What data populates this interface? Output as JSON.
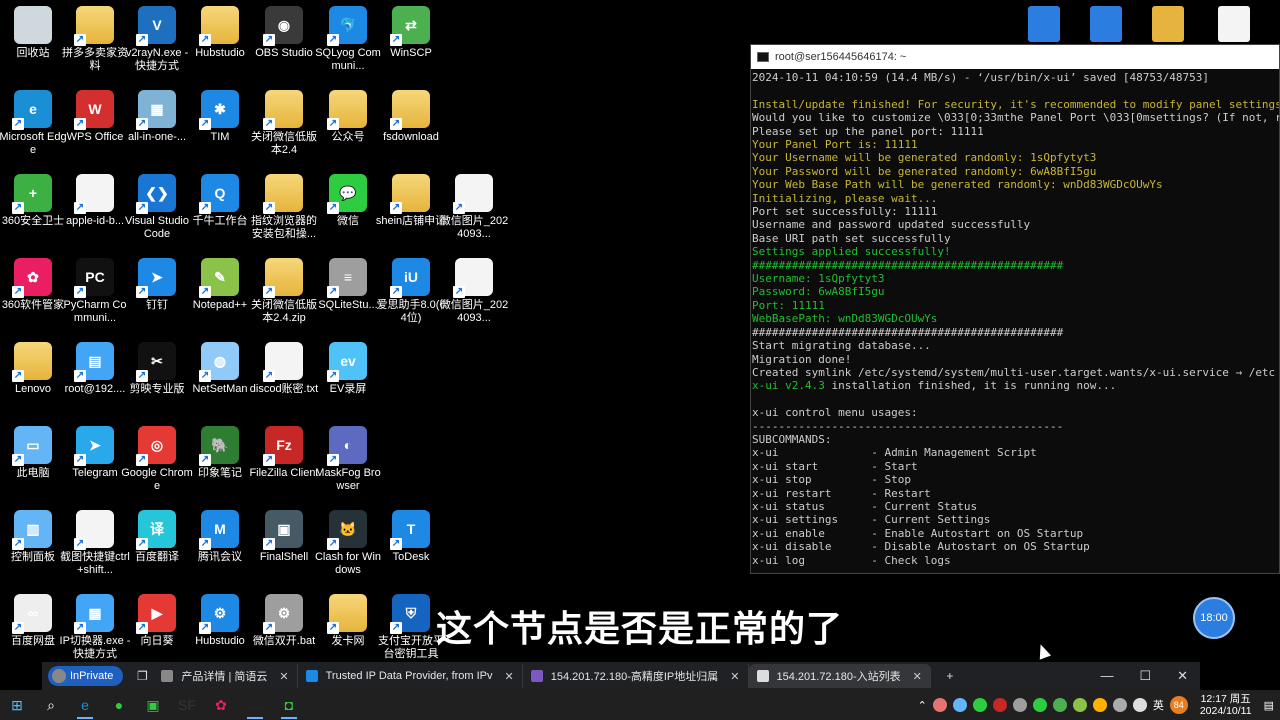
{
  "desktop": {
    "icons": [
      {
        "label": "回收站",
        "color": "#cfd8dc",
        "kind": "bin"
      },
      {
        "label": "拼多多卖家资料",
        "color": "#e6b43c",
        "kind": "folder"
      },
      {
        "label": "v2rayN.exe - 快捷方式",
        "color": "#1f6fbf",
        "kind": "app",
        "glyph": "V"
      },
      {
        "label": "Hubstudio",
        "color": "#e6b43c",
        "kind": "folder"
      },
      {
        "label": "OBS Studio",
        "color": "#3a3a3a",
        "kind": "app",
        "glyph": "◉"
      },
      {
        "label": "SQLyog Communi...",
        "color": "#1e88e5",
        "kind": "app",
        "glyph": "🐬"
      },
      {
        "label": "WinSCP",
        "color": "#4caf50",
        "kind": "app",
        "glyph": "⇄"
      },
      {
        "label": "Microsoft Edge",
        "color": "#1a8fd6",
        "kind": "app",
        "glyph": "e"
      },
      {
        "label": "WPS Office",
        "color": "#d32f2f",
        "kind": "app",
        "glyph": "W"
      },
      {
        "label": "all-in-one-...",
        "color": "#7fb3d5",
        "kind": "app",
        "glyph": "▦"
      },
      {
        "label": "TIM",
        "color": "#1e88e5",
        "kind": "app",
        "glyph": "✱"
      },
      {
        "label": "关闭微信低版本2.4",
        "color": "#e6b43c",
        "kind": "folder"
      },
      {
        "label": "公众号",
        "color": "#e6b43c",
        "kind": "folder"
      },
      {
        "label": "fsdownload",
        "color": "#e6b43c",
        "kind": "folder"
      },
      {
        "label": "360安全卫士",
        "color": "#3cb043",
        "kind": "app",
        "glyph": "+"
      },
      {
        "label": "apple-id-b...",
        "color": "#eeeeee",
        "kind": "doc"
      },
      {
        "label": "Visual Studio Code",
        "color": "#1976d2",
        "kind": "app",
        "glyph": "❮❯"
      },
      {
        "label": "千牛工作台",
        "color": "#1e88e5",
        "kind": "app",
        "glyph": "Q"
      },
      {
        "label": "指纹浏览器的安装包和操...",
        "color": "#e6b43c",
        "kind": "folder"
      },
      {
        "label": "微信",
        "color": "#2ecc40",
        "kind": "app",
        "glyph": "💬"
      },
      {
        "label": "shein店铺申请",
        "color": "#e6b43c",
        "kind": "folder"
      },
      {
        "label": "微信图片_2024093...",
        "color": "#eeeeee",
        "kind": "doc"
      },
      {
        "label": "360软件管家",
        "color": "#e91e63",
        "kind": "app",
        "glyph": "✿"
      },
      {
        "label": "PyCharm Communi...",
        "color": "#111111",
        "kind": "app",
        "glyph": "PC"
      },
      {
        "label": "钉钉",
        "color": "#1e88e5",
        "kind": "app",
        "glyph": "➤"
      },
      {
        "label": "Notepad++",
        "color": "#8bc34a",
        "kind": "app",
        "glyph": "✎"
      },
      {
        "label": "关闭微信低版本2.4.zip",
        "color": "#e6b43c",
        "kind": "folder"
      },
      {
        "label": "SQLiteStu...",
        "color": "#9e9e9e",
        "kind": "app",
        "glyph": "≡"
      },
      {
        "label": "爱思助手8.0(64位)",
        "color": "#1e88e5",
        "kind": "app",
        "glyph": "iU"
      },
      {
        "label": "微信图片_2024093...",
        "color": "#eeeeee",
        "kind": "doc"
      },
      {
        "label": "Lenovo",
        "color": "#e6b43c",
        "kind": "folder"
      },
      {
        "label": "root@192....",
        "color": "#42a5f5",
        "kind": "app",
        "glyph": "▤"
      },
      {
        "label": "剪映专业版",
        "color": "#111111",
        "kind": "app",
        "glyph": "✂"
      },
      {
        "label": "NetSetMan",
        "color": "#90caf9",
        "kind": "app",
        "glyph": "◍"
      },
      {
        "label": "discod账密.txt",
        "color": "#f4f4f4",
        "kind": "doc"
      },
      {
        "label": "EV录屏",
        "color": "#4fc3f7",
        "kind": "app",
        "glyph": "ev"
      },
      {
        "label": "此电脑",
        "color": "#64b5f6",
        "kind": "app",
        "glyph": "▭"
      },
      {
        "label": "Telegram",
        "color": "#29a9eb",
        "kind": "app",
        "glyph": "➤"
      },
      {
        "label": "Google Chrome",
        "color": "#e53935",
        "kind": "app",
        "glyph": "◎"
      },
      {
        "label": "印象笔记",
        "color": "#2e7d32",
        "kind": "app",
        "glyph": "🐘"
      },
      {
        "label": "FileZilla Client",
        "color": "#c62828",
        "kind": "app",
        "glyph": "Fz"
      },
      {
        "label": "MaskFog Browser",
        "color": "#5c6bc0",
        "kind": "app",
        "glyph": "◐"
      },
      {
        "label": "控制面板",
        "color": "#64b5f6",
        "kind": "app",
        "glyph": "▥"
      },
      {
        "label": "截图快捷键ctrl+shift...",
        "color": "#f4f4f4",
        "kind": "doc"
      },
      {
        "label": "百度翻译",
        "color": "#26c6da",
        "kind": "app",
        "glyph": "译"
      },
      {
        "label": "腾讯会议",
        "color": "#1e88e5",
        "kind": "app",
        "glyph": "M"
      },
      {
        "label": "FinalShell",
        "color": "#455a64",
        "kind": "app",
        "glyph": "▣"
      },
      {
        "label": "Clash for Windows",
        "color": "#263238",
        "kind": "app",
        "glyph": "🐱"
      },
      {
        "label": "ToDesk",
        "color": "#1e88e5",
        "kind": "app",
        "glyph": "T"
      },
      {
        "label": "百度网盘",
        "color": "#eeeeee",
        "kind": "app",
        "glyph": "∞"
      },
      {
        "label": "IP切换器.exe - 快捷方式",
        "color": "#42a5f5",
        "kind": "app",
        "glyph": "▦"
      },
      {
        "label": "向日葵",
        "color": "#e53935",
        "kind": "app",
        "glyph": "▶"
      },
      {
        "label": "Hubstudio",
        "color": "#1e88e5",
        "kind": "app",
        "glyph": "⚙"
      },
      {
        "label": "微信双开.bat",
        "color": "#9e9e9e",
        "kind": "app",
        "glyph": "⚙"
      },
      {
        "label": "发卡网",
        "color": "#e6b43c",
        "kind": "folder"
      },
      {
        "label": "支付宝开放平台密钥工具",
        "color": "#1565c0",
        "kind": "app",
        "glyph": "⛨"
      }
    ]
  },
  "top_right_icons": [
    {
      "name": "wps-doc-icon",
      "color": "#2b7de0"
    },
    {
      "name": "wps-doc-icon-2",
      "color": "#2b7de0"
    },
    {
      "name": "archive-icon",
      "color": "#e6b43c"
    },
    {
      "name": "blank-doc-icon",
      "color": "#f4f4f4"
    }
  ],
  "terminal": {
    "title": "root@ser156445646174: ~",
    "lines": [
      {
        "t": "2024-10-11 04:10:59 (14.4 MB/s) - ‘/usr/bin/x-ui’ saved [48753/48753]",
        "c": "white"
      },
      {
        "t": "",
        "c": "white"
      },
      {
        "t": "Install/update finished! For security, it's recommended to modify panel settings",
        "c": "yellow"
      },
      {
        "t": "Would you like to customize \\033[0;33mthe Panel Port \\033[0msettings? (If not, r",
        "c": "white"
      },
      {
        "t": "Please set up the panel port: 11111",
        "c": "white"
      },
      {
        "t": "Your Panel Port is: 11111",
        "c": "yellow"
      },
      {
        "t": "Your Username will be generated randomly: 1sQpfytyt3",
        "c": "yellow"
      },
      {
        "t": "Your Password will be generated randomly: 6wA8BfI5gu",
        "c": "yellow"
      },
      {
        "t": "Your Web Base Path will be generated randomly: wnDd83WGDcOUwYs",
        "c": "yellow"
      },
      {
        "t": "Initializing, please wait...",
        "c": "yellow"
      },
      {
        "t": "Port set successfully: 11111",
        "c": "white"
      },
      {
        "t": "Username and password updated successfully",
        "c": "white"
      },
      {
        "t": "Base URI path set successfully",
        "c": "white"
      },
      {
        "t": "Settings applied successfully!",
        "c": "green"
      },
      {
        "t": "###############################################",
        "c": "green"
      },
      {
        "t": "Username: 1sQpfytyt3",
        "c": "green"
      },
      {
        "t": "Password: 6wA8BfI5gu",
        "c": "green"
      },
      {
        "t": "Port: 11111",
        "c": "green"
      },
      {
        "t": "WebBasePath: wnDd83WGDcOUwYs",
        "c": "green"
      },
      {
        "t": "###############################################",
        "c": "white"
      },
      {
        "t": "Start migrating database...",
        "c": "white"
      },
      {
        "t": "Migration done!",
        "c": "white"
      },
      {
        "t": "Created symlink /etc/systemd/system/multi-user.target.wants/x-ui.service → /etc",
        "c": "white"
      },
      {
        "t": "x-ui v2.4.3 installation finished, it is running now...",
        "c": "mixed-green"
      },
      {
        "t": "",
        "c": "white"
      },
      {
        "t": "x-ui control menu usages:",
        "c": "white"
      },
      {
        "t": "-----------------------------------------------",
        "c": "white"
      },
      {
        "t": "SUBCOMMANDS:",
        "c": "white"
      },
      {
        "t": "x-ui              - Admin Management Script",
        "c": "white"
      },
      {
        "t": "x-ui start        - Start",
        "c": "white"
      },
      {
        "t": "x-ui stop         - Stop",
        "c": "white"
      },
      {
        "t": "x-ui restart      - Restart",
        "c": "white"
      },
      {
        "t": "x-ui status       - Current Status",
        "c": "white"
      },
      {
        "t": "x-ui settings     - Current Settings",
        "c": "white"
      },
      {
        "t": "x-ui enable       - Enable Autostart on OS Startup",
        "c": "white"
      },
      {
        "t": "x-ui disable      - Disable Autostart on OS Startup",
        "c": "white"
      },
      {
        "t": "x-ui log          - Check logs",
        "c": "white"
      }
    ]
  },
  "subtitle": "这个节点是否是正常的了",
  "bubble": "18:00",
  "browser": {
    "inprivate": "InPrivate",
    "tabs": [
      {
        "label": "产品详情 | 简语云",
        "fav": "#888888",
        "active": false
      },
      {
        "label": "Trusted IP Data Provider, from IPv",
        "fav": "#1e88e5",
        "active": false
      },
      {
        "label": "154.201.72.180-高精度IP地址归属",
        "fav": "#7e57c2",
        "active": false
      },
      {
        "label": "154.201.72.180-入站列表",
        "fav": "#dddddd",
        "active": true
      }
    ],
    "new_tab": "+",
    "controls": [
      "—",
      "☐",
      "✕"
    ]
  },
  "taskbar": {
    "apps": [
      {
        "name": "start-icon",
        "color": "#4fc3f7",
        "glyph": "⊞"
      },
      {
        "name": "search-icon",
        "color": "#ffffff",
        "glyph": "⌕"
      },
      {
        "name": "edge-taskbar-icon",
        "color": "#1a8fd6",
        "glyph": "e",
        "active": true
      },
      {
        "name": "wechat-taskbar-icon",
        "color": "#2ecc40",
        "glyph": "●"
      },
      {
        "name": "greenapp-taskbar-icon",
        "color": "#2ecc40",
        "glyph": "▣"
      },
      {
        "name": "sf-taskbar-icon",
        "color": "#333333",
        "glyph": "SF"
      },
      {
        "name": "flower-taskbar-icon",
        "color": "#e91e63",
        "glyph": "✿"
      },
      {
        "name": "terminal-taskbar-icon",
        "color": "#222222",
        "glyph": "▬",
        "active": true
      },
      {
        "name": "green-taskbar-icon",
        "color": "#2ecc40",
        "glyph": "◘",
        "active": true
      }
    ],
    "tray_chevron": "⌃",
    "lang": "英",
    "badge": "84",
    "time": "12:17 周五",
    "date": "2024/10/11",
    "notif": "▤"
  }
}
